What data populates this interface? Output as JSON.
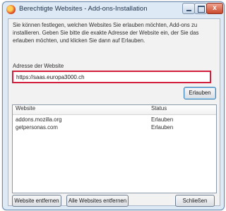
{
  "window": {
    "title": "Berechtigte Websites - Add-ons-Installation",
    "close_symbol": "x"
  },
  "dialog": {
    "description": "Sie können festlegen, welchen Websites Sie erlauben möchten, Add-ons zu installieren. Geben Sie bitte die exakte Adresse der Website ein, der Sie das erlauben möchten, und klicken Sie dann auf Erlauben.",
    "url_label": "Adresse der Website",
    "url_value": "https://saas.europa3000.ch",
    "allow_button": "Erlauben"
  },
  "list": {
    "columns": [
      "Website",
      "Status"
    ],
    "rows": [
      {
        "website": "addons.mozilla.org",
        "status": "Erlauben"
      },
      {
        "website": "getpersonas.com",
        "status": "Erlauben"
      }
    ]
  },
  "buttons": {
    "remove_site": "Website entfernen",
    "remove_all": "Alle Websites entfernen",
    "close": "Schließen"
  },
  "colors": {
    "input_highlight": "#d21f3c",
    "window_frame": "#dde9f5"
  }
}
